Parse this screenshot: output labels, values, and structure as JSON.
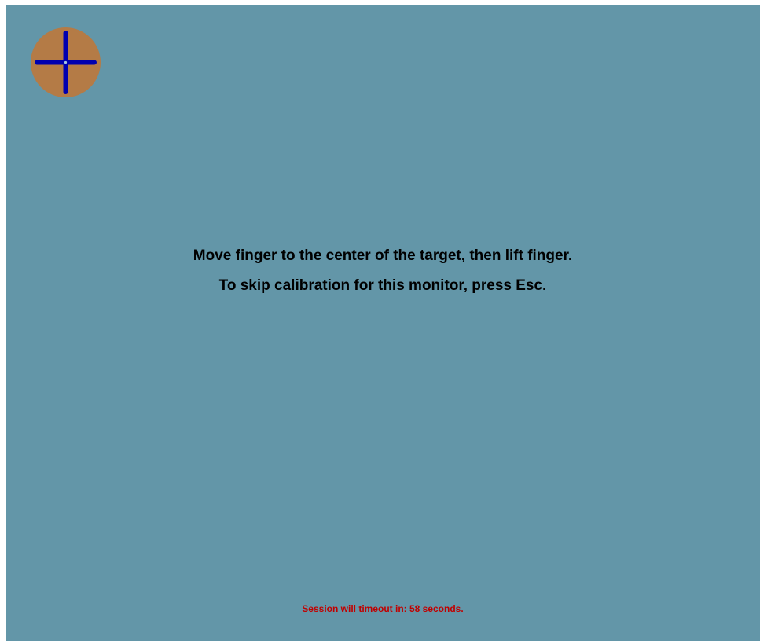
{
  "colors": {
    "background": "#6396a8",
    "target_fill": "#b47b46",
    "crosshair": "#0000b0",
    "crosshair_center": "#a9c6dd",
    "timeout_text": "#c00000"
  },
  "target": {
    "icon": "calibration-crosshair-icon"
  },
  "instructions": {
    "line1": "Move finger to the center of the target, then lift finger.",
    "line2": "To skip calibration for this monitor, press Esc."
  },
  "timeout": {
    "text": "Session will timeout in: 58 seconds."
  }
}
